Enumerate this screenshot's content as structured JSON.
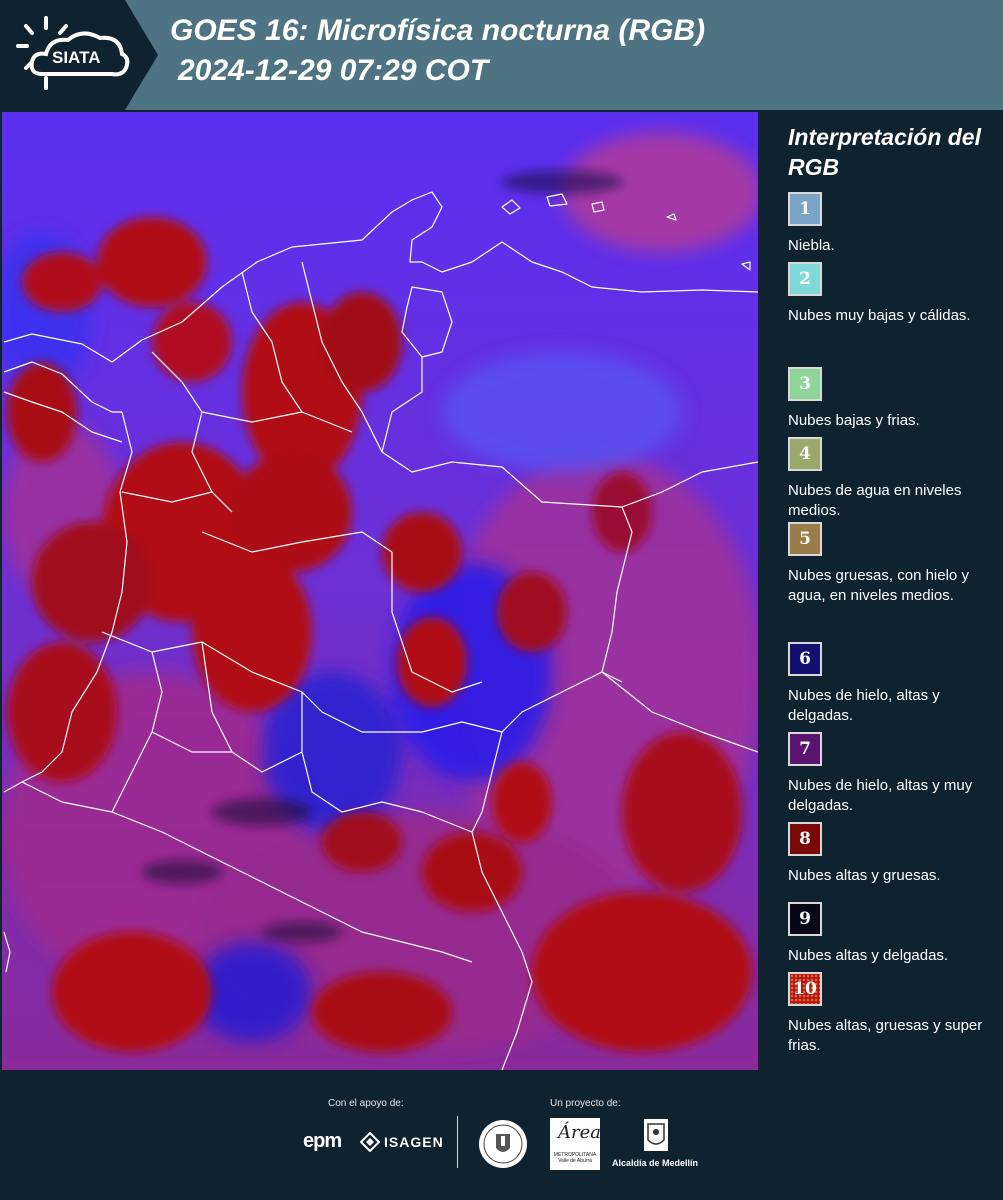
{
  "header": {
    "title_line1": "GOES 16: Microfísica nocturna (RGB)",
    "title_line2": "2024-12-29 07:29 COT",
    "logo_text": "SIATA",
    "band_color": "#4e7483",
    "background_color": "#0f2230"
  },
  "legend": {
    "title": "Interpretación del RGB",
    "items": [
      {
        "number": "1",
        "label": "Niebla.",
        "color": "#7ba3c7"
      },
      {
        "number": "2",
        "label": "Nubes muy bajas y cálidas.",
        "color": "#7fd9d6"
      },
      {
        "number": "3",
        "label": "Nubes bajas y frias.",
        "color": "#8fd498"
      },
      {
        "number": "4",
        "label": "Nubes de agua en niveles medios.",
        "color": "#9aa96b"
      },
      {
        "number": "5",
        "label": "Nubes gruesas, con hielo y agua, en niveles medios.",
        "color": "#9a7b4a"
      },
      {
        "number": "6",
        "label": "Nubes de hielo, altas y delgadas.",
        "color": "#121070"
      },
      {
        "number": "7",
        "label": "Nubes de hielo, altas y muy delgadas.",
        "color": "#5a1470"
      },
      {
        "number": "8",
        "label": "Nubes altas y gruesas.",
        "color": "#7a0a0a"
      },
      {
        "number": "9",
        "label": "Nubes altas y delgadas.",
        "color": "#080818"
      },
      {
        "number": "10",
        "label": "Nubes altas, gruesas y super frias.",
        "color": "#b01a10"
      }
    ]
  },
  "footer": {
    "support_label": "Con el apoyo de:",
    "project_label": "Un proyecto de:",
    "epm_text": "epm",
    "isagen_text": "ISAGEN",
    "area_text": "Área",
    "area_subtext": "METROPOLITANA Valle de Aburrá",
    "medellin_text": "Alcaldía de Medellín"
  }
}
